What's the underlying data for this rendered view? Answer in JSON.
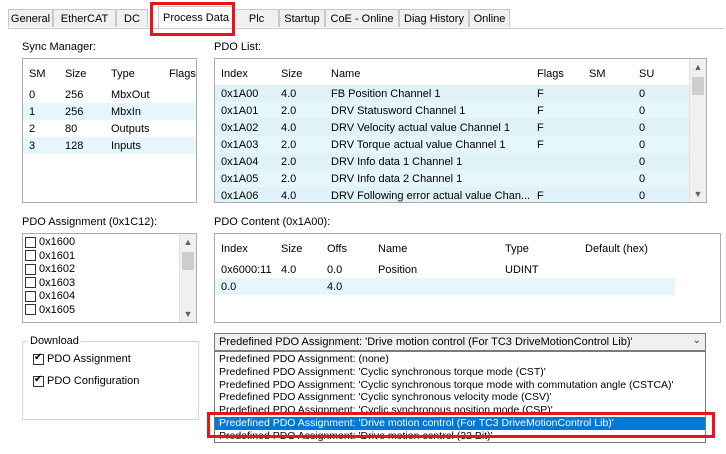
{
  "tabs": [
    "General",
    "EtherCAT",
    "DC",
    "Process Data",
    "Plc",
    "Startup",
    "CoE - Online",
    "Diag History",
    "Online"
  ],
  "sync_manager": {
    "label": "Sync Manager:",
    "headers": [
      "SM",
      "Size",
      "Type",
      "Flags"
    ],
    "rows": [
      [
        "0",
        "256",
        "MbxOut",
        ""
      ],
      [
        "1",
        "256",
        "MbxIn",
        ""
      ],
      [
        "2",
        "80",
        "Outputs",
        ""
      ],
      [
        "3",
        "128",
        "Inputs",
        ""
      ]
    ]
  },
  "pdo_list": {
    "label": "PDO List:",
    "headers": [
      "Index",
      "Size",
      "Name",
      "Flags",
      "SM",
      "SU"
    ],
    "rows": [
      [
        "0x1A00",
        "4.0",
        "FB Position Channel 1",
        "F",
        "",
        "0"
      ],
      [
        "0x1A01",
        "2.0",
        "DRV Statusword Channel 1",
        "F",
        "",
        "0"
      ],
      [
        "0x1A02",
        "4.0",
        "DRV Velocity actual value Channel 1",
        "F",
        "",
        "0"
      ],
      [
        "0x1A03",
        "2.0",
        "DRV Torque actual value Channel 1",
        "F",
        "",
        "0"
      ],
      [
        "0x1A04",
        "2.0",
        "DRV Info data 1 Channel 1",
        "",
        "",
        "0"
      ],
      [
        "0x1A05",
        "2.0",
        "DRV Info data 2 Channel 1",
        "",
        "",
        "0"
      ],
      [
        "0x1A06",
        "4.0",
        "DRV Following error actual value Chan...",
        "F",
        "",
        "0"
      ]
    ]
  },
  "pdo_assignment": {
    "label": "PDO Assignment (0x1C12):",
    "items": [
      "0x1600",
      "0x1601",
      "0x1602",
      "0x1603",
      "0x1604",
      "0x1605"
    ]
  },
  "pdo_content": {
    "label": "PDO Content (0x1A00):",
    "headers": [
      "Index",
      "Size",
      "Offs",
      "Name",
      "Type",
      "Default (hex)"
    ],
    "rows": [
      [
        "0x6000:11",
        "4.0",
        "0.0",
        "Position",
        "UDINT",
        ""
      ],
      [
        "0.0",
        "",
        "4.0",
        "",
        "",
        ""
      ]
    ]
  },
  "download": {
    "label": "Download",
    "pdo_assignment": "PDO Assignment",
    "pdo_configuration": "PDO Configuration"
  },
  "predefined": {
    "selected": "Predefined PDO Assignment: 'Drive motion control (For TC3 DriveMotionControl Lib)'",
    "options": [
      "Predefined PDO Assignment: (none)",
      "Predefined PDO Assignment: 'Cyclic synchronous torque mode (CST)'",
      "Predefined PDO Assignment: 'Cyclic synchronous torque mode with commutation angle (CSTCA)'",
      "Predefined PDO Assignment: 'Cyclic synchronous velocity mode (CSV)'",
      "Predefined PDO Assignment: 'Cyclic synchronous position mode (CSP)'",
      "Predefined PDO Assignment: 'Drive motion control (For TC3 DriveMotionControl Lib)'",
      "Predefined PDO Assignment: 'Drive motion control (32 Bit)'"
    ],
    "selected_index": 5
  },
  "colors": {
    "highlight": "#e6f7fb",
    "selection": "#0078d7",
    "annotation": "#e8141a"
  }
}
